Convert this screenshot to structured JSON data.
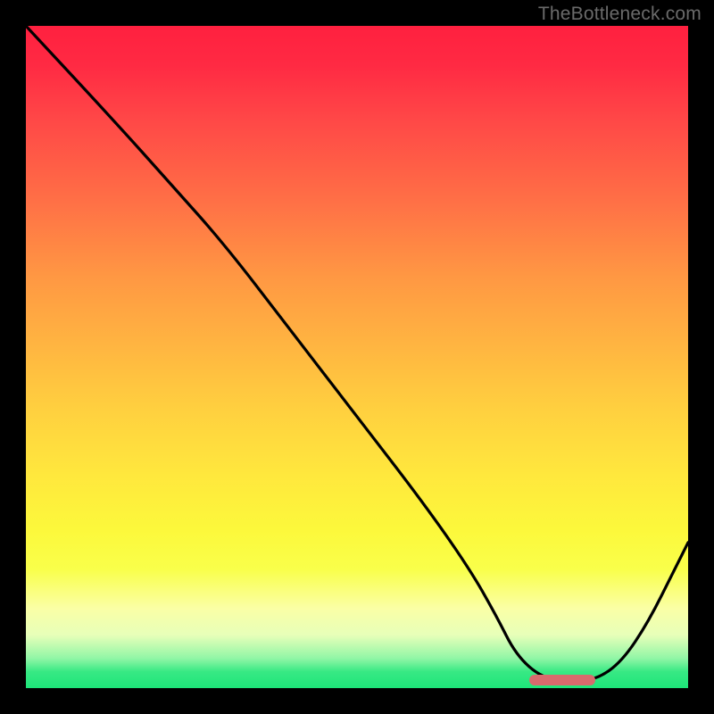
{
  "watermark": "TheBottleneck.com",
  "chart_data": {
    "type": "line",
    "title": "",
    "xlabel": "",
    "ylabel": "",
    "xlim": [
      0,
      100
    ],
    "ylim": [
      0,
      100
    ],
    "grid": false,
    "legend": false,
    "series": [
      {
        "name": "curve",
        "color": "#000000",
        "x": [
          0,
          13,
          22,
          30,
          40,
          50,
          60,
          67,
          71,
          74,
          78,
          82,
          86,
          90,
          94,
          98,
          100
        ],
        "values": [
          100,
          86,
          76,
          67,
          54,
          41,
          28,
          18,
          11,
          5,
          1.5,
          1.2,
          1.2,
          4,
          10,
          18,
          22
        ]
      }
    ],
    "marker": {
      "name": "highlight-bar",
      "color": "#d86a6d",
      "x_start": 76,
      "x_end": 86,
      "y": 1.2,
      "thickness_pct": 1.7
    },
    "background": {
      "type": "vertical-gradient",
      "stops": [
        {
          "pos": 0,
          "color": "#ff203f"
        },
        {
          "pos": 50,
          "color": "#ffc040"
        },
        {
          "pos": 80,
          "color": "#fcff40"
        },
        {
          "pos": 100,
          "color": "#1de579"
        }
      ]
    }
  }
}
